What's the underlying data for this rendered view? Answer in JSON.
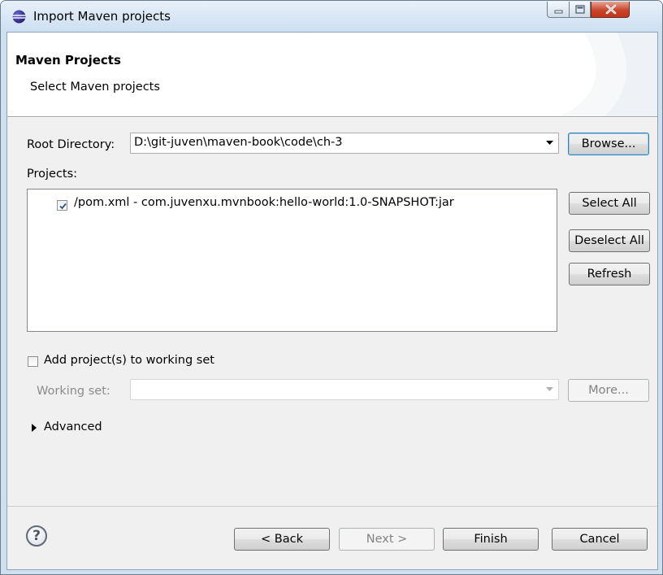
{
  "window": {
    "title": "Import Maven projects",
    "accent_color": "#cfe0f1"
  },
  "header": {
    "title": "Maven Projects",
    "description": "Select Maven projects"
  },
  "root_directory": {
    "label": "Root Directory:",
    "value": "D:\\git-juven\\maven-book\\code\\ch-3",
    "browse_label": "Browse..."
  },
  "projects": {
    "label": "Projects:",
    "items": [
      {
        "checked": true,
        "text": "/pom.xml - com.juvenxu.mvnbook:hello-world:1.0-SNAPSHOT:jar"
      }
    ],
    "select_all_label": "Select All",
    "deselect_all_label": "Deselect All",
    "refresh_label": "Refresh"
  },
  "working_set": {
    "checkbox_label": "Add project(s) to working set",
    "checked": false,
    "label": "Working set:",
    "value": "",
    "more_label": "More..."
  },
  "advanced": {
    "label": "Advanced"
  },
  "footer": {
    "back_label": "< Back",
    "next_label": "Next >",
    "finish_label": "Finish",
    "cancel_label": "Cancel"
  },
  "icons": {
    "title": "eclipse-icon",
    "help": "help-icon"
  }
}
